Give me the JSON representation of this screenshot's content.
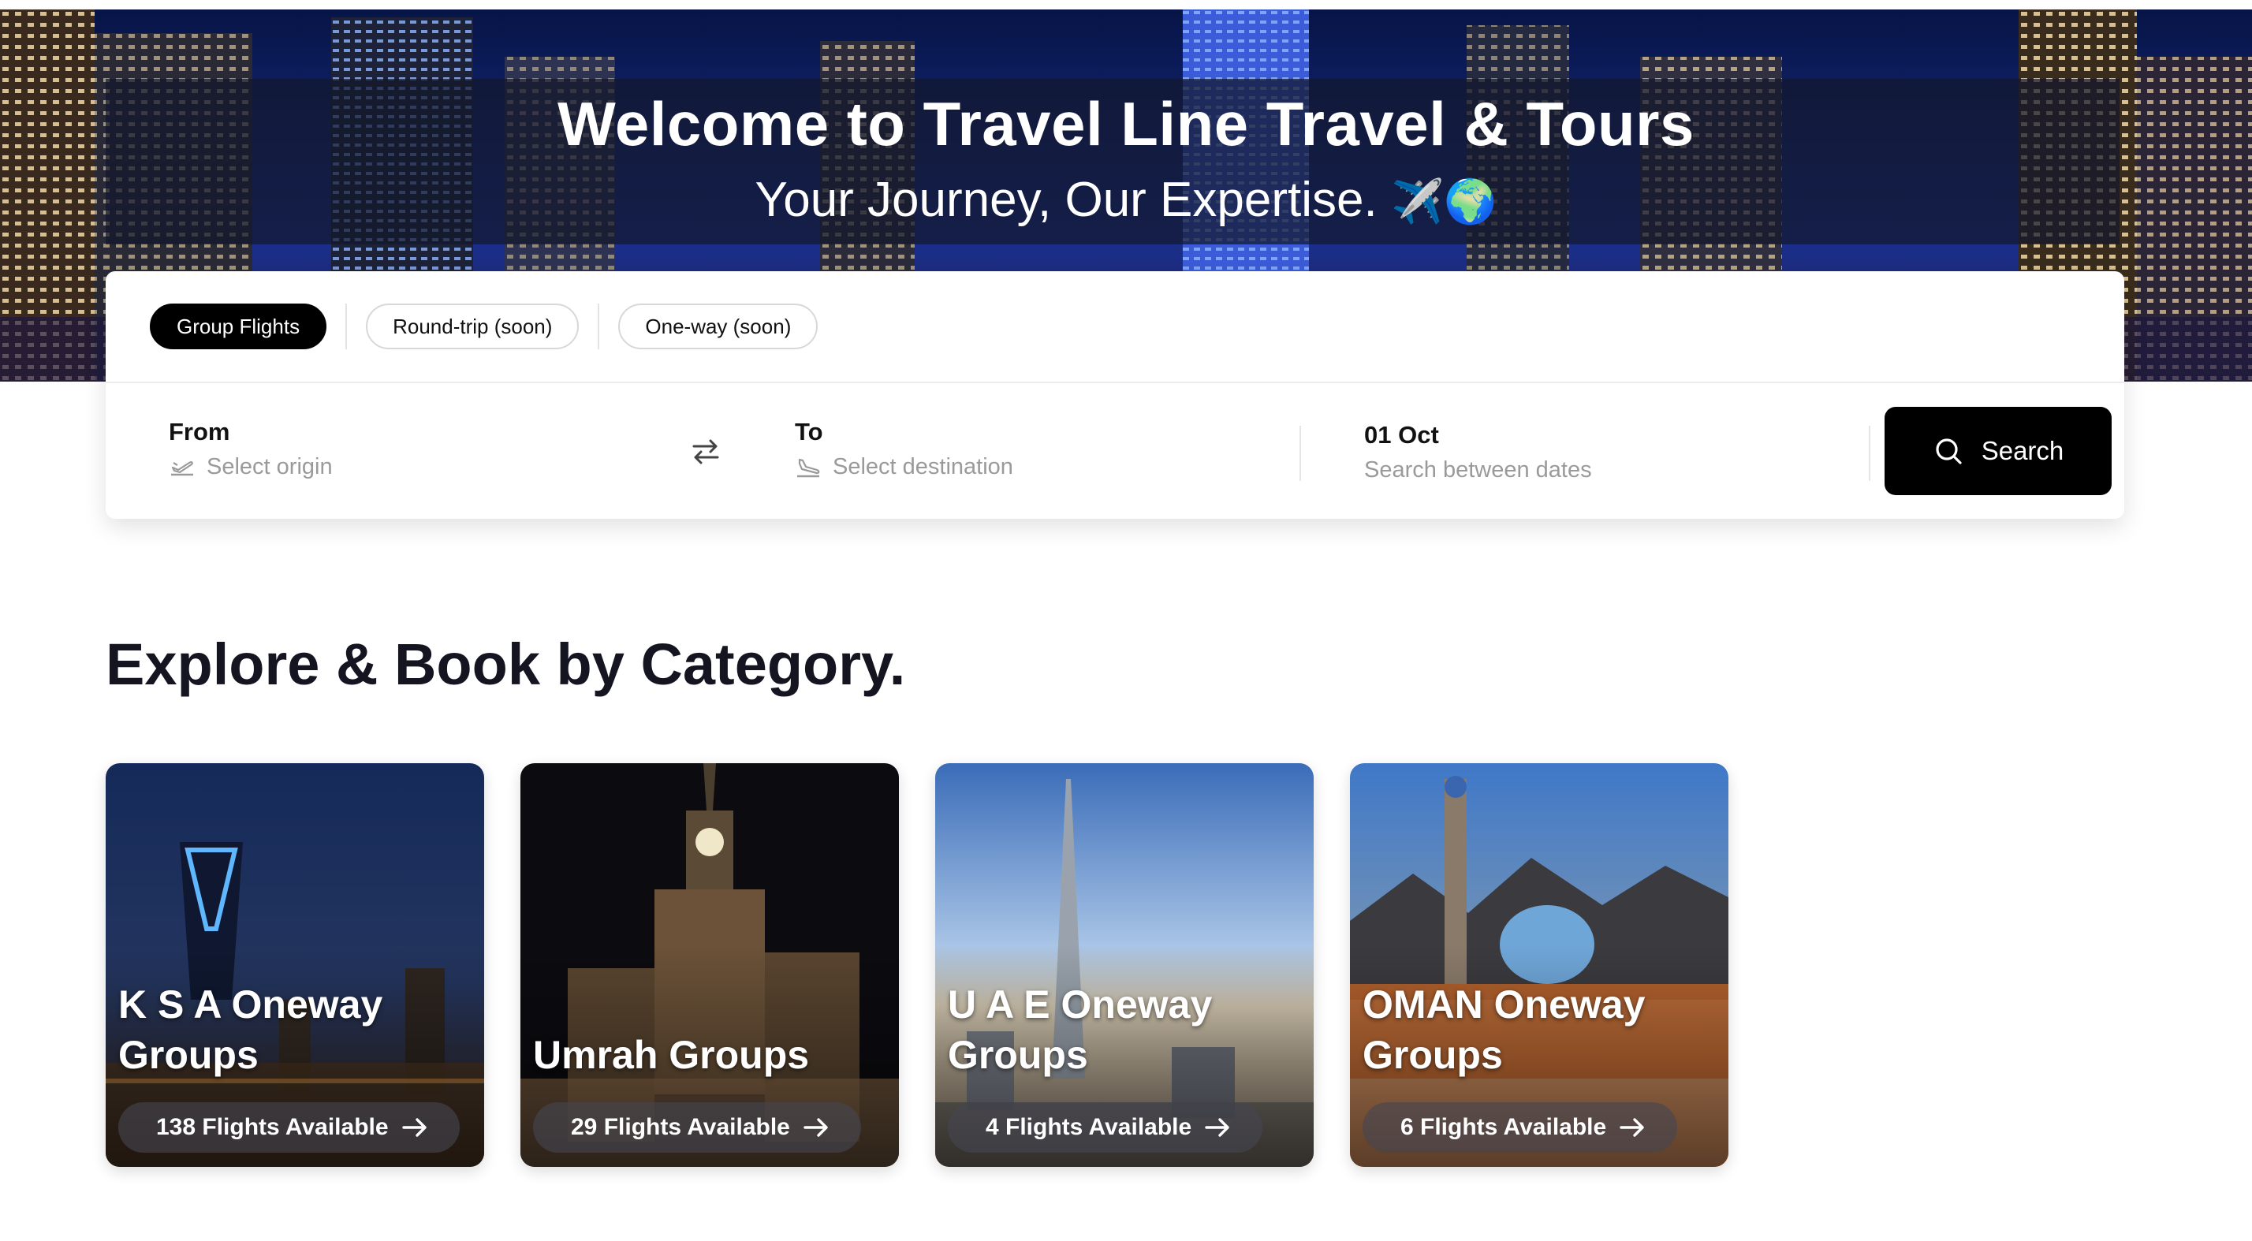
{
  "hero": {
    "title": "Welcome to Travel Line Travel & Tours",
    "subtitle": "Your Journey, Our Expertise.",
    "subtitle_emoji": "✈️🌍"
  },
  "tabs": [
    {
      "label": "Group Flights",
      "active": true
    },
    {
      "label": "Round-trip (soon)",
      "active": false
    },
    {
      "label": "One-way (soon)",
      "active": false
    }
  ],
  "search": {
    "from_label": "From",
    "from_placeholder": "Select origin",
    "to_label": "To",
    "to_placeholder": "Select destination",
    "date_value": "01 Oct",
    "date_hint": "Search between dates",
    "button_label": "Search"
  },
  "section": {
    "title": "Explore & Book by Category."
  },
  "categories": [
    {
      "title_line1": "K S A Oneway",
      "title_line2": "Groups",
      "flights": "138 Flights Available"
    },
    {
      "title_line1": "",
      "title_line2": "Umrah Groups",
      "flights": "29 Flights Available"
    },
    {
      "title_line1": "U A E Oneway",
      "title_line2": "Groups",
      "flights": "4 Flights Available"
    },
    {
      "title_line1": "OMAN Oneway",
      "title_line2": "Groups",
      "flights": "6 Flights Available"
    }
  ],
  "colors": {
    "primary": "#000000",
    "text": "#151521",
    "muted": "#9a9a9a"
  },
  "icons": {
    "origin": "takeoff-icon",
    "destination": "landing-icon",
    "swap": "swap-arrows-icon",
    "search": "search-icon",
    "arrow": "arrow-right-icon"
  }
}
